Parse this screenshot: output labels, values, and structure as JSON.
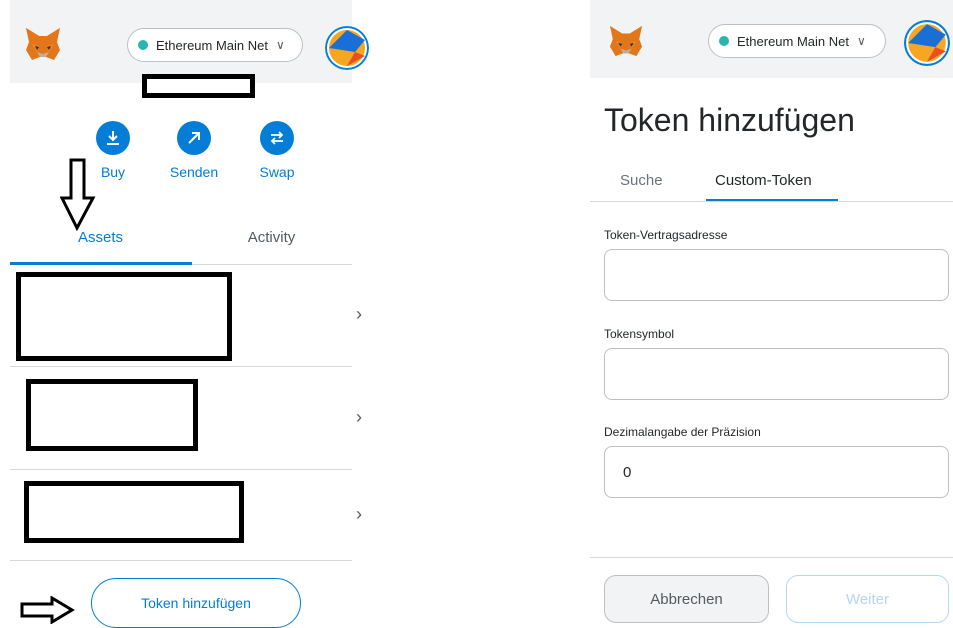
{
  "left": {
    "network": {
      "label": "Ethereum Main Net",
      "dot_color": "#29b6af"
    },
    "actions": [
      {
        "label": "Buy",
        "icon": "download-icon"
      },
      {
        "label": "Senden",
        "icon": "arrow-up-right-icon"
      },
      {
        "label": "Swap",
        "icon": "swap-icon"
      }
    ],
    "tabs": {
      "assets": "Assets",
      "activity": "Activity"
    },
    "add_token_label": "Token hinzufügen"
  },
  "right": {
    "network": {
      "label": "Ethereum Main Net",
      "dot_color": "#29b6af"
    },
    "title": "Token hinzufügen",
    "tabs": {
      "search": "Suche",
      "custom": "Custom-Token"
    },
    "fields": {
      "address_label": "Token-Vertragsadresse",
      "address_value": "",
      "symbol_label": "Tokensymbol",
      "symbol_value": "",
      "decimals_label": "Dezimalangabe der Präzision",
      "decimals_value": "0"
    },
    "cancel_label": "Abbrechen",
    "next_label": "Weiter"
  },
  "colors": {
    "accent": "#037dd6",
    "muted": "#bbc0c5"
  }
}
